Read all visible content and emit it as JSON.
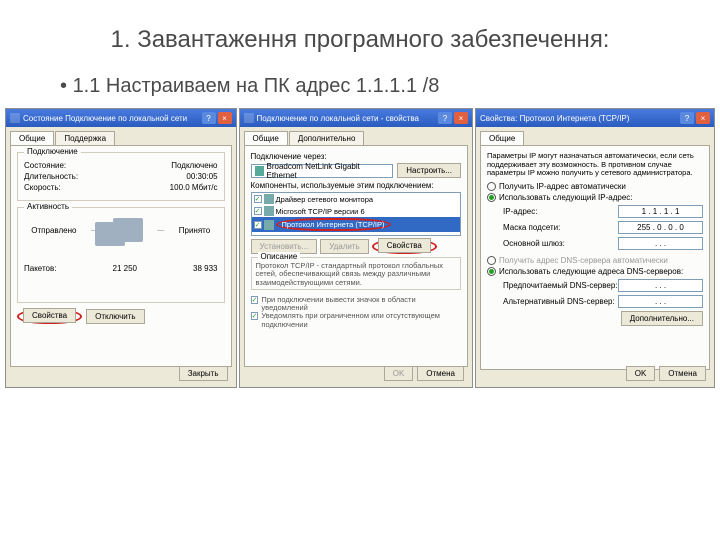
{
  "slide": {
    "title": "1. Завантаження програмного забезпечення:",
    "bullet": "1.1 Настраиваем на ПК адрес 1.1.1.1 /8"
  },
  "dialog1": {
    "title": "Состояние Подключение по локальной сети",
    "tabs": {
      "general": "Общие",
      "support": "Поддержка"
    },
    "group_conn": "Подключение",
    "status_label": "Состояние:",
    "status_value": "Подключено",
    "duration_label": "Длительность:",
    "duration_value": "00:30:05",
    "speed_label": "Скорость:",
    "speed_value": "100.0 Мбит/с",
    "group_act": "Активность",
    "sent": "Отправлено",
    "received": "Принято",
    "packets_label": "Пакетов:",
    "sent_count": "21 250",
    "recv_count": "38 933",
    "btn_props": "Свойства",
    "btn_disable": "Отключить",
    "btn_close": "Закрыть"
  },
  "dialog2": {
    "title": "Подключение по локальной сети - свойства",
    "tabs": {
      "general": "Общие",
      "extra": "Дополнительно"
    },
    "connect_using": "Подключение через:",
    "adapter": "Broadcom NetLink Gigabit Ethernet",
    "btn_config": "Настроить...",
    "components_label": "Компоненты, используемые этим подключением:",
    "item1": "Драйвер сетевого монитора",
    "item2": "Microsoft TCP/IP версии 6",
    "item3": "Протокол Интернета (TCP/IP)",
    "btn_install": "Установить...",
    "btn_remove": "Удалить",
    "btn_props": "Свойства",
    "desc_title": "Описание",
    "desc_text": "Протокол TCP/IP - стандартный протокол глобальных сетей, обеспечивающий связь между различными взаимодействующими сетями.",
    "chk_icon": "При подключении вывести значок в области уведомлений",
    "chk_notify": "Уведомлять при ограниченном или отсутствующем подключении",
    "btn_ok": "OK",
    "btn_cancel": "Отмена"
  },
  "dialog3": {
    "title": "Свойства: Протокол Интернета (TCP/IP)",
    "tabs": {
      "general": "Общие"
    },
    "intro": "Параметры IP могут назначаться автоматически, если сеть поддерживает эту возможность. В противном случае параметры IP можно получить у сетевого администратора.",
    "radio_auto_ip": "Получить IP-адрес автоматически",
    "radio_manual_ip": "Использовать следующий IP-адрес:",
    "ip_label": "IP-адрес:",
    "ip_value": "1 . 1 . 1 . 1",
    "mask_label": "Маска подсети:",
    "mask_value": "255 . 0 . 0 . 0",
    "gw_label": "Основной шлюз:",
    "gw_value": ". . .",
    "radio_auto_dns": "Получить адрес DNS-сервера автоматически",
    "radio_manual_dns": "Использовать следующие адреса DNS-серверов:",
    "dns1_label": "Предпочитаемый DNS-сервер:",
    "dns_blank": ". . .",
    "dns2_label": "Альтернативный DNS-сервер:",
    "btn_adv": "Дополнительно...",
    "btn_ok": "OK",
    "btn_cancel": "Отмена"
  }
}
